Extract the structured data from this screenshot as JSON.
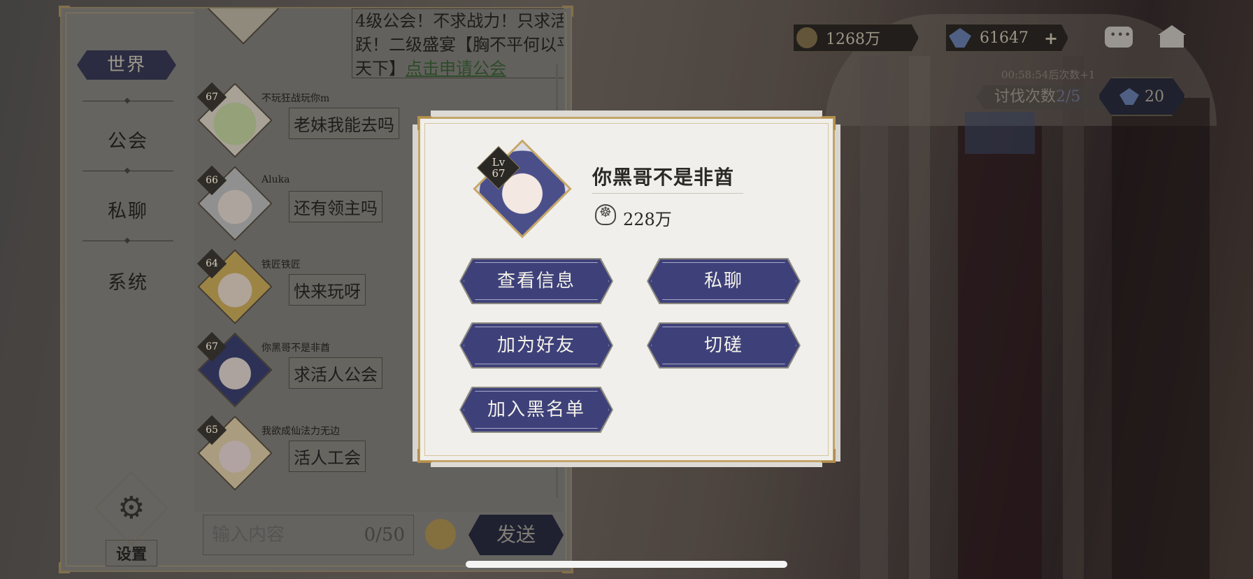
{
  "hud": {
    "gold": "1268万",
    "gems": "61647",
    "gems_plus": "+",
    "timer": "00:58:54后次数+1",
    "battle_label": "讨伐次数",
    "battle_current": "2",
    "battle_total": "/5",
    "tickets": "20",
    "icons": {
      "gold": "coin-icon",
      "gems": "gem-icon",
      "chat": "chat-bubble-icon",
      "mail": "mail-icon"
    }
  },
  "sidebar": {
    "items": [
      {
        "label": "世界"
      },
      {
        "label": "公会"
      },
      {
        "label": "私聊"
      },
      {
        "label": "系统"
      }
    ],
    "settings_label": "设置"
  },
  "chat": {
    "top_message": {
      "text": "4级公会！不求战力！只求活跃！二级盛宴【胸不平何以平天下】",
      "link": "点击申请公会"
    },
    "messages": [
      {
        "level": "67",
        "name": "不玩狂战玩你m",
        "text": "老妹我能去吗"
      },
      {
        "level": "66",
        "name": "Aluka",
        "text": "还有领主吗"
      },
      {
        "level": "64",
        "name": "铁匠铁匠",
        "text": "快来玩呀"
      },
      {
        "level": "67",
        "name": "你黑哥不是非酋",
        "text": "求活人公会"
      },
      {
        "level": "65",
        "name": "我欲成仙法力无边",
        "text": "活人工会"
      }
    ],
    "input_placeholder": "输入内容",
    "input_counter": "0/50",
    "send_label": "发送"
  },
  "modal": {
    "lv_label": "Lv",
    "level": "67",
    "player_name": "你黑哥不是非酋",
    "power": "228万",
    "buttons": {
      "view_info": "查看信息",
      "private_chat": "私聊",
      "add_friend": "加为好友",
      "spar": "切磋",
      "blacklist": "加入黑名单"
    }
  },
  "colors": {
    "button": "#3e4179",
    "gold_border": "#c3a56a",
    "modal_bg": "#f0efec"
  }
}
